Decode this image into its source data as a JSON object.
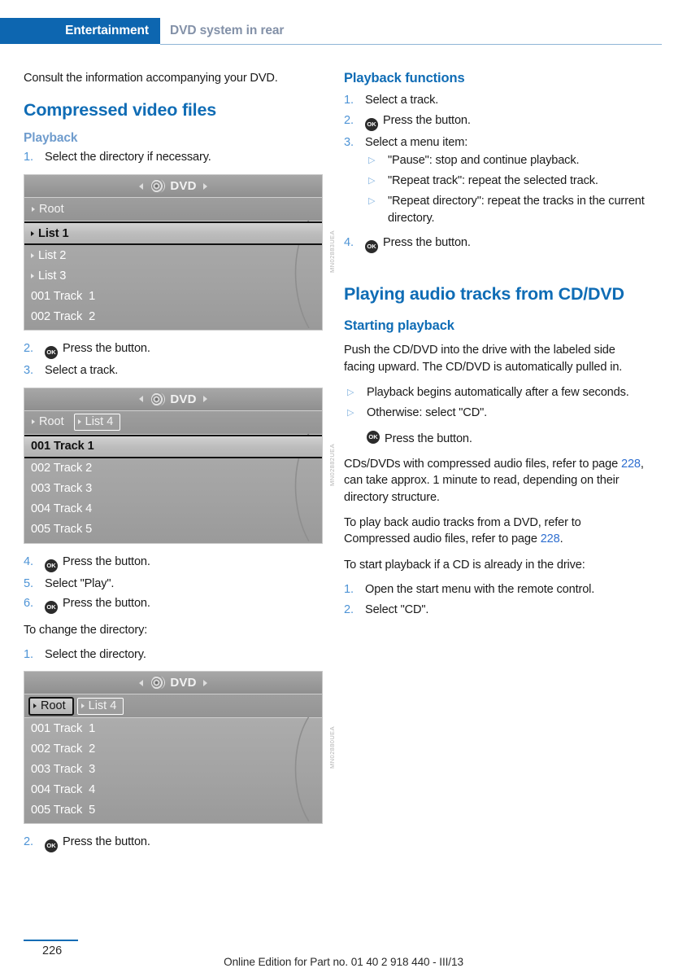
{
  "header": {
    "tab_label": "Entertainment",
    "section_label": "DVD system in rear"
  },
  "left_column": {
    "intro_paragraph": "Consult the information accompanying your DVD.",
    "heading_compressed_video": "Compressed video files",
    "subheading_playback": "Playback",
    "step1": {
      "num": "1.",
      "text": "Select the directory if necessary."
    },
    "step2": {
      "num": "2.",
      "text": "Press the button."
    },
    "step3": {
      "num": "3.",
      "text": "Select a track."
    },
    "step4": {
      "num": "4.",
      "text": "Press the button."
    },
    "step5": {
      "num": "5.",
      "text": "Select \"Play\"."
    },
    "step6": {
      "num": "6.",
      "text": "Press the button."
    },
    "change_dir_lead": "To change the directory:",
    "dir_step1": {
      "num": "1.",
      "text": "Select the directory."
    },
    "dir_step2": {
      "num": "2.",
      "text": "Press the button."
    },
    "ok_glyph": "OK"
  },
  "figures": [
    {
      "id": "dvd-browser-directories",
      "title": "DVD",
      "left_arrow": "◄",
      "right_arrow": "►",
      "watermark": "MN02883UEA",
      "breadcrumbs": [
        {
          "label": "Root",
          "state": "plain"
        }
      ],
      "rows": [
        {
          "label": "List 1",
          "type": "folder",
          "selected": true
        },
        {
          "label": "List 2",
          "type": "folder",
          "selected": false
        },
        {
          "label": "List 3",
          "type": "folder",
          "selected": false
        },
        {
          "label": "001 Track  1",
          "type": "track",
          "selected": false
        },
        {
          "label": "002 Track  2",
          "type": "track",
          "selected": false
        }
      ]
    },
    {
      "id": "dvd-browser-tracks-in-list4",
      "title": "DVD",
      "left_arrow": "◄",
      "right_arrow": "►",
      "watermark": "MN02882UEA",
      "breadcrumbs": [
        {
          "label": "Root",
          "state": "plain"
        },
        {
          "label": "List 4",
          "state": "boxed"
        }
      ],
      "rows": [
        {
          "label": "001 Track 1",
          "type": "track",
          "selected": true
        },
        {
          "label": "002 Track 2",
          "type": "track",
          "selected": false
        },
        {
          "label": "003 Track 3",
          "type": "track",
          "selected": false
        },
        {
          "label": "004 Track 4",
          "type": "track",
          "selected": false
        },
        {
          "label": "005 Track 5",
          "type": "track",
          "selected": false
        }
      ]
    },
    {
      "id": "dvd-browser-root-selected",
      "title": "DVD",
      "left_arrow": "◄",
      "right_arrow": "►",
      "watermark": "MN02880UEA",
      "breadcrumbs": [
        {
          "label": "Root",
          "state": "selected"
        },
        {
          "label": "List 4",
          "state": "boxed"
        }
      ],
      "rows": [
        {
          "label": "001 Track  1",
          "type": "track",
          "selected": false
        },
        {
          "label": "002 Track  2",
          "type": "track",
          "selected": false
        },
        {
          "label": "003 Track  3",
          "type": "track",
          "selected": false
        },
        {
          "label": "004 Track  4",
          "type": "track",
          "selected": false
        },
        {
          "label": "005 Track  5",
          "type": "track",
          "selected": false
        }
      ]
    }
  ],
  "right_column": {
    "heading_playback_functions": "Playback functions",
    "pf_step1": {
      "num": "1.",
      "text": "Select a track."
    },
    "pf_step2": {
      "num": "2.",
      "text": "Press the button."
    },
    "pf_step3": {
      "num": "3.",
      "text": "Select a menu item:"
    },
    "pf_sub1": "\"Pause\": stop and continue playback.",
    "pf_sub2": "\"Repeat track\": repeat the selected track.",
    "pf_sub3": "\"Repeat directory\": repeat the tracks in the current directory.",
    "pf_step4": {
      "num": "4.",
      "text": "Press the button."
    },
    "heading_playing_audio": "Playing audio tracks from CD/DVD",
    "heading_starting_playback": "Starting playback",
    "push_paragraph": "Push the CD/DVD into the drive with the labeled side facing upward. The CD/DVD is automatically pulled in.",
    "sp_sub1": "Playback begins automatically after a few seconds.",
    "sp_sub2": "Otherwise: select \"CD\".",
    "sp_sub2_press": "Press the button.",
    "cds_para_a": "CDs/DVDs with compressed audio files, refer to page ",
    "cds_ref1": "228",
    "cds_para_b": ", can take approx. 1 minute to read, depending on their directory structure.",
    "dvd_para_a": "To play back audio tracks from a DVD, refer to Compressed audio files, refer to page ",
    "dvd_ref1": "228",
    "dvd_para_b": ".",
    "start_lead": "To start playback if a CD is already in the drive:",
    "sl_step1": {
      "num": "1.",
      "text": "Open the start menu with the remote control."
    },
    "sl_step2": {
      "num": "2.",
      "text": "Select \"CD\"."
    },
    "bullet_marker": "▷"
  },
  "footer": {
    "page_number": "226",
    "note": "Online Edition for Part no. 01 40 2 918 440 - III/13"
  },
  "colors": {
    "brand_blue": "#0d66b0",
    "heading_blue": "#0f6cb5",
    "muted_blue": "#8391a8",
    "light_blue": "#6f9ccd",
    "link_blue": "#2f6fd0",
    "step_num_blue": "#4e94d6"
  }
}
